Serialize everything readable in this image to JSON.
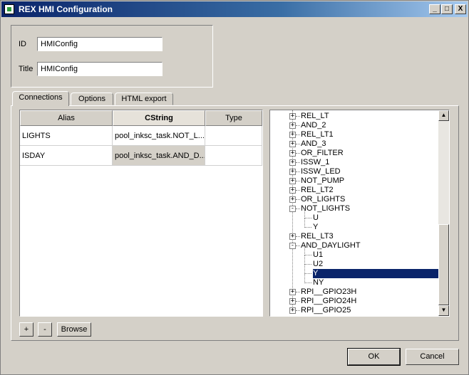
{
  "window": {
    "title": "REX HMI Configuration",
    "min_glyph": "_",
    "max_glyph": "□",
    "close_glyph": "X"
  },
  "form": {
    "id_label": "ID",
    "id_value": "HMIConfig",
    "title_label": "Title",
    "title_value": "HMIConfig"
  },
  "tabs": [
    {
      "label": "Connections",
      "active": true
    },
    {
      "label": "Options",
      "active": false
    },
    {
      "label": "HTML export",
      "active": false
    }
  ],
  "table": {
    "columns": [
      "Alias",
      "CString",
      "Type"
    ],
    "rows": [
      {
        "alias": "LIGHTS",
        "cstring": "pool_inksc_task.NOT_L...",
        "type": ""
      },
      {
        "alias": "ISDAY",
        "cstring": "pool_inksc_task.AND_D...",
        "type": ""
      }
    ]
  },
  "tree": {
    "items": [
      {
        "label": "REL_LT",
        "level": 0,
        "expander": "+"
      },
      {
        "label": "AND_2",
        "level": 0,
        "expander": "+"
      },
      {
        "label": "REL_LT1",
        "level": 0,
        "expander": "+"
      },
      {
        "label": "AND_3",
        "level": 0,
        "expander": "+"
      },
      {
        "label": "OR_FILTER",
        "level": 0,
        "expander": "+"
      },
      {
        "label": "ISSW_1",
        "level": 0,
        "expander": "+"
      },
      {
        "label": "ISSW_LED",
        "level": 0,
        "expander": "+"
      },
      {
        "label": "NOT_PUMP",
        "level": 0,
        "expander": "+"
      },
      {
        "label": "REL_LT2",
        "level": 0,
        "expander": "+"
      },
      {
        "label": "OR_LIGHTS",
        "level": 0,
        "expander": "+"
      },
      {
        "label": "NOT_LIGHTS",
        "level": 0,
        "expander": "-"
      },
      {
        "label": "U",
        "level": 1,
        "expander": ""
      },
      {
        "label": "Y",
        "level": 1,
        "expander": ""
      },
      {
        "label": "REL_LT3",
        "level": 0,
        "expander": "+"
      },
      {
        "label": "AND_DAYLIGHT",
        "level": 0,
        "expander": "-"
      },
      {
        "label": "U1",
        "level": 1,
        "expander": ""
      },
      {
        "label": "U2",
        "level": 1,
        "expander": ""
      },
      {
        "label": "Y",
        "level": 1,
        "expander": "",
        "selected": true
      },
      {
        "label": "NY",
        "level": 1,
        "expander": ""
      },
      {
        "label": "RPI__GPIO23H",
        "level": 0,
        "expander": "+"
      },
      {
        "label": "RPI__GPIO24H",
        "level": 0,
        "expander": "+"
      },
      {
        "label": "RPI__GPIO25",
        "level": 0,
        "expander": "+"
      }
    ]
  },
  "scrollbar": {
    "up_glyph": "▲",
    "down_glyph": "▼"
  },
  "row_buttons": {
    "add": "+",
    "remove": "-",
    "browse": "Browse"
  },
  "dialog_buttons": {
    "ok": "OK",
    "cancel": "Cancel"
  },
  "colors": {
    "selection": "#0a246a",
    "face": "#d4d0c8",
    "title_start": "#0a246a",
    "title_end": "#a6caf0"
  }
}
